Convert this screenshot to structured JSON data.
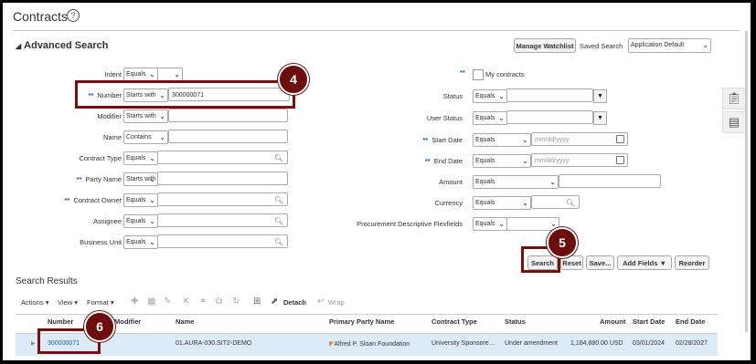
{
  "page": {
    "title": "Contracts",
    "help_icon": "?"
  },
  "advanced_search": {
    "label": "Advanced Search",
    "collapse_icon": "triangle-down"
  },
  "header_actions": {
    "manage_watchlist": "Manage Watchlist",
    "saved_search_label": "Saved Search",
    "saved_search_value": "Application Default"
  },
  "left_fields": {
    "intent": {
      "label": "Intent",
      "operator": "Equals"
    },
    "number": {
      "label": "Number",
      "operator": "Starts with",
      "value": "300000071"
    },
    "modifier": {
      "label": "Modifier",
      "operator": "Starts with"
    },
    "name": {
      "label": "Name",
      "operator": "Contains"
    },
    "contract_type": {
      "label": "Contract Type",
      "operator": "Equals"
    },
    "party_name": {
      "label": "Party Name",
      "operator": "Starts with"
    },
    "contract_owner": {
      "label": "Contract Owner",
      "operator": "Equals"
    },
    "assignee": {
      "label": "Assignee",
      "operator": "Equals"
    },
    "business_unit": {
      "label": "Business Unit",
      "operator": "Equals"
    }
  },
  "required_marker": "**",
  "right_fields": {
    "my_contracts": {
      "label": "My contracts"
    },
    "status": {
      "label": "Status",
      "operator": "Equals"
    },
    "user_status": {
      "label": "User Status",
      "operator": "Equals"
    },
    "start_date": {
      "label": "Start Date",
      "operator": "Equals",
      "placeholder": "mm/dd/yyyy"
    },
    "end_date": {
      "label": "End Date",
      "operator": "Equals",
      "placeholder": "mm/dd/yyyy"
    },
    "amount": {
      "label": "Amount",
      "operator": "Equals"
    },
    "currency": {
      "label": "Currency",
      "operator": "Equals"
    },
    "procurement_dff": {
      "label": "Procurement Descriptive Flexfields",
      "operator": "Equals"
    }
  },
  "buttons": {
    "search": "Search",
    "reset": "Reset",
    "save": "Save...",
    "add_fields": "Add Fields",
    "reorder": "Reorder"
  },
  "callouts": {
    "c4": "4",
    "c5": "5",
    "c6": "6"
  },
  "results": {
    "title": "Search Results",
    "toolbar": {
      "actions": "Actions",
      "view": "View",
      "format": "Format",
      "detach": "Detach",
      "wrap": "Wrap"
    },
    "columns": [
      "Number",
      "Modifier",
      "Name",
      "Primary Party Name",
      "Contract Type",
      "Status",
      "Amount",
      "Start Date",
      "End Date"
    ],
    "rows": [
      {
        "number": "300000071",
        "modifier": "",
        "name": "01.AURA-030.SIT2-DEMO",
        "primary_party": "Alfred P. Sloan Foundation",
        "contract_type": "University Sponsore…",
        "status": "Under amendment",
        "amount": "1,184,880.00",
        "currency": "USD",
        "start_date": "03/01/2024",
        "end_date": "02/28/2027"
      }
    ]
  },
  "colors": {
    "accent_red": "#7a0d0d",
    "link": "#1b5fa8",
    "row_selected": "#ddeaf7"
  }
}
